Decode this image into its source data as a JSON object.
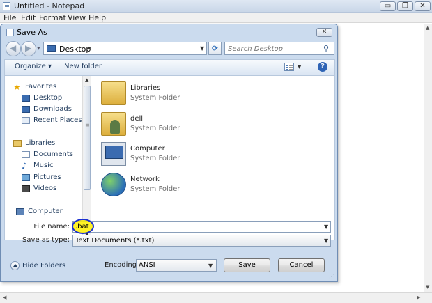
{
  "notepad": {
    "title": "Untitled - Notepad",
    "menu": [
      "File",
      "Edit",
      "Format",
      "View",
      "Help"
    ],
    "controls": {
      "minimize": "▭",
      "maximize": "❐",
      "close": "✕"
    }
  },
  "dialog": {
    "title": "Save As",
    "close": "✕",
    "address": {
      "location": "Desktop",
      "separator": "▸"
    },
    "search": {
      "placeholder": "Search Desktop"
    },
    "toolbar": {
      "organize": "Organize ▾",
      "new_folder": "New folder",
      "help": "?"
    },
    "nav_pane": [
      {
        "label": "Favorites",
        "icon": "star-icon"
      },
      {
        "label": "Desktop",
        "icon": "desktop-icon"
      },
      {
        "label": "Downloads",
        "icon": "downloads-icon"
      },
      {
        "label": "Recent Places",
        "icon": "recent-places-icon"
      },
      {
        "label": "Libraries",
        "icon": "libraries-icon"
      },
      {
        "label": "Documents",
        "icon": "documents-icon"
      },
      {
        "label": "Music",
        "icon": "music-icon"
      },
      {
        "label": "Pictures",
        "icon": "pictures-icon"
      },
      {
        "label": "Videos",
        "icon": "videos-icon"
      },
      {
        "label": "Computer",
        "icon": "computer-icon"
      }
    ],
    "files": [
      {
        "name": "Libraries",
        "type": "System Folder",
        "icon": "libraries-folder-icon"
      },
      {
        "name": "dell",
        "type": "System Folder",
        "icon": "user-folder-icon"
      },
      {
        "name": "Computer",
        "type": "System Folder",
        "icon": "computer-icon"
      },
      {
        "name": "Network",
        "type": "System Folder",
        "icon": "network-icon"
      }
    ],
    "file_name": {
      "label": "File name:",
      "value": ".bat"
    },
    "save_as_type": {
      "label": "Save as type:",
      "value": "Text Documents (*.txt)"
    },
    "hide_folders": "Hide Folders",
    "encoding": {
      "label": "Encoding:",
      "value": "ANSI"
    },
    "buttons": {
      "save": "Save",
      "cancel": "Cancel"
    }
  },
  "colors": {
    "annotation_highlight": "#fff000",
    "annotation_outline": "#1a2fd0"
  }
}
